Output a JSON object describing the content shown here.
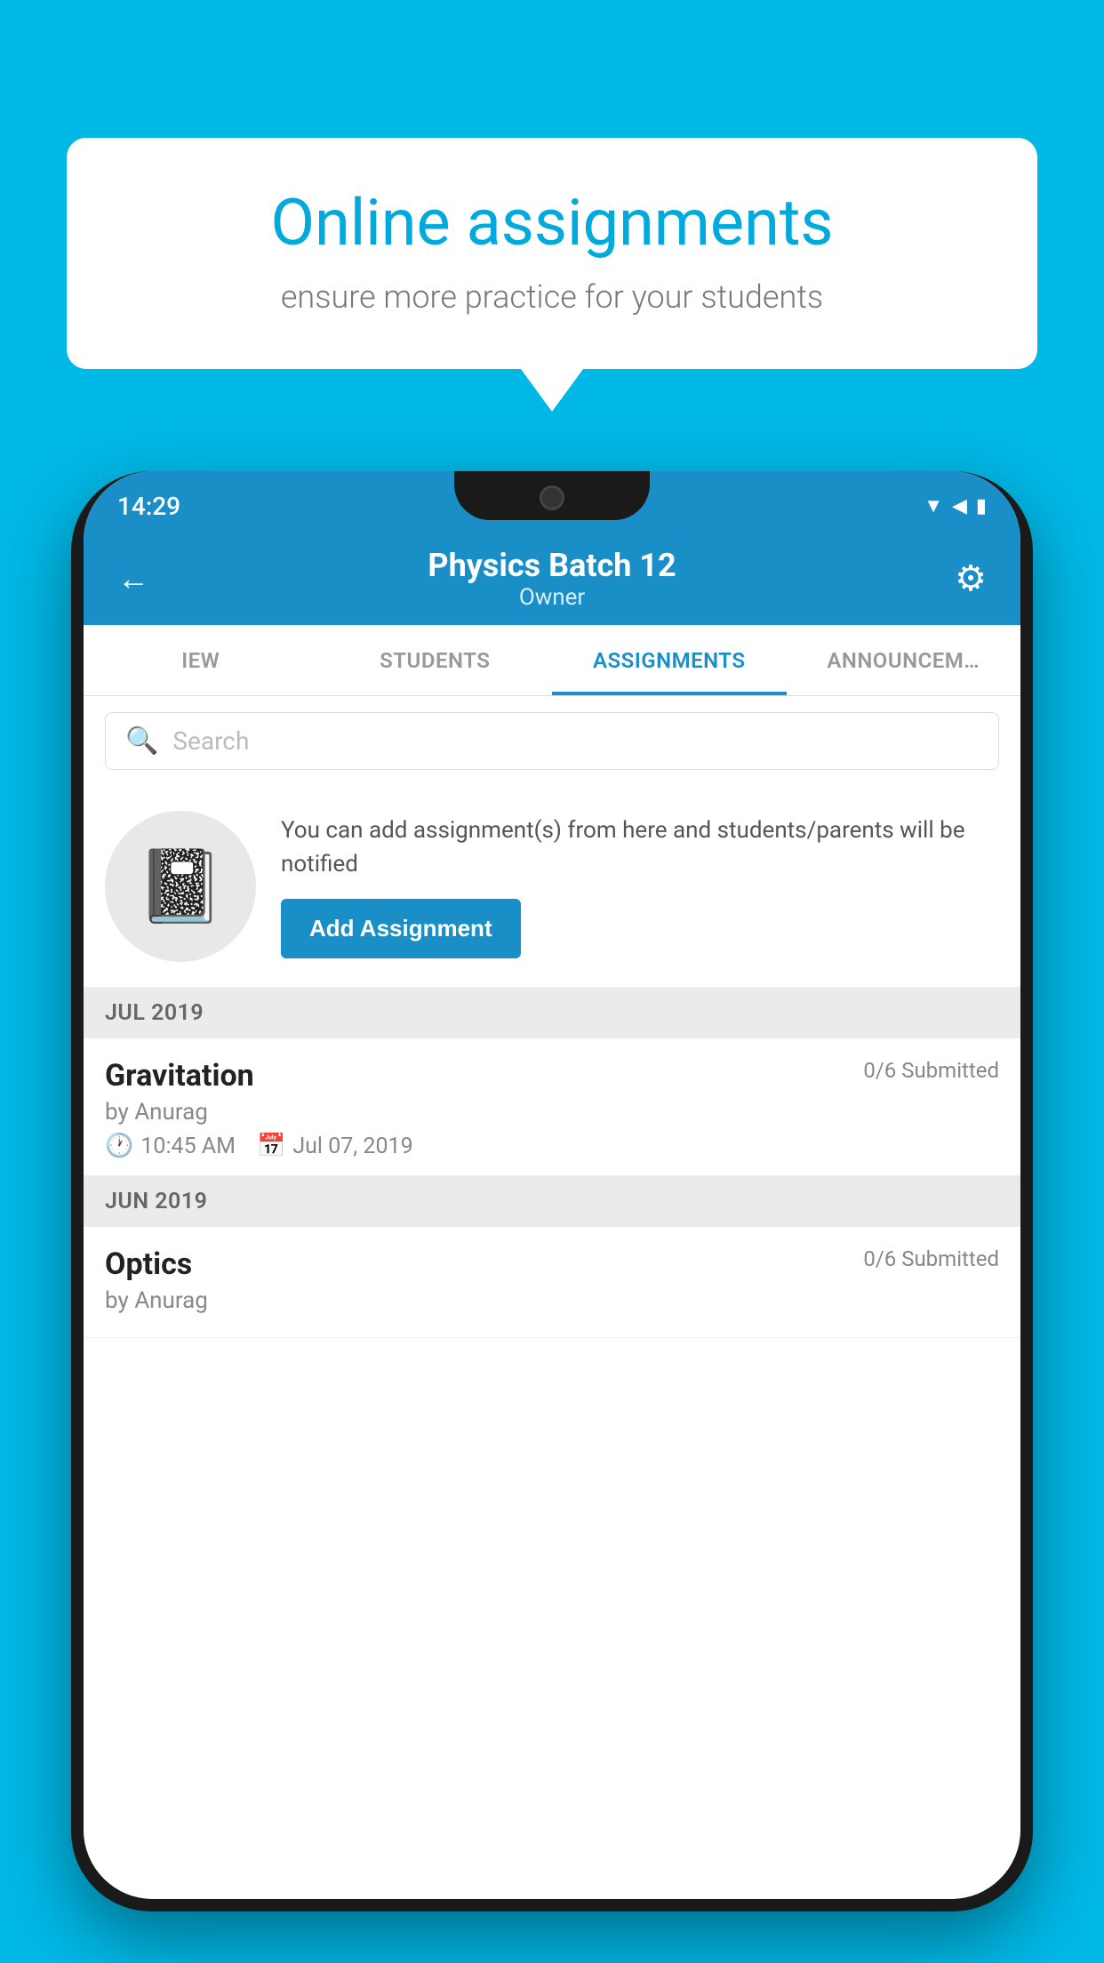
{
  "background_color": "#00B8E6",
  "speech_bubble": {
    "title": "Online assignments",
    "subtitle": "ensure more practice for your students"
  },
  "status_bar": {
    "time": "14:29",
    "wifi_icon": "wifi",
    "signal_icon": "signal",
    "battery_icon": "battery"
  },
  "header": {
    "title": "Physics Batch 12",
    "subtitle": "Owner",
    "back_label": "←",
    "settings_label": "⚙"
  },
  "tabs": [
    {
      "id": "iew",
      "label": "IEW",
      "active": false
    },
    {
      "id": "students",
      "label": "STUDENTS",
      "active": false
    },
    {
      "id": "assignments",
      "label": "ASSIGNMENTS",
      "active": true
    },
    {
      "id": "announcements",
      "label": "ANNOUNCEM…",
      "active": false
    }
  ],
  "search": {
    "placeholder": "Search"
  },
  "promo": {
    "description": "You can add assignment(s) from here and students/parents will be notified",
    "button_label": "Add Assignment"
  },
  "sections": [
    {
      "label": "JUL 2019",
      "assignments": [
        {
          "name": "Gravitation",
          "status": "0/6 Submitted",
          "by": "by Anurag",
          "time": "10:45 AM",
          "date": "Jul 07, 2019"
        }
      ]
    },
    {
      "label": "JUN 2019",
      "assignments": [
        {
          "name": "Optics",
          "status": "0/6 Submitted",
          "by": "by Anurag",
          "time": "",
          "date": ""
        }
      ]
    }
  ]
}
